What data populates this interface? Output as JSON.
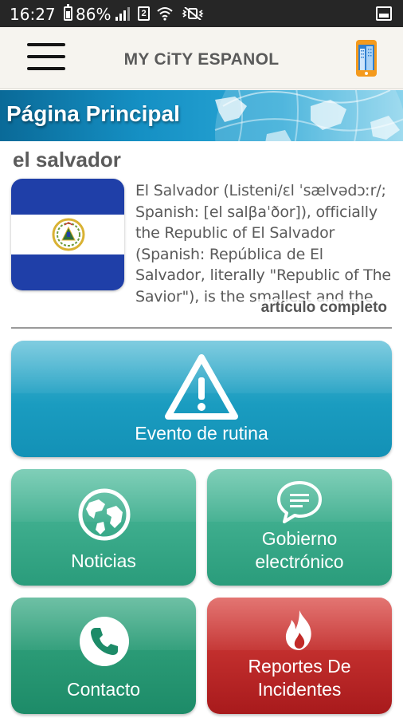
{
  "status_bar": {
    "time": "16:27",
    "battery": "86%",
    "sim_label": "2"
  },
  "app": {
    "title": "MY CiTY ESPANOL"
  },
  "banner": {
    "title": "Página Principal"
  },
  "article": {
    "heading": "el salvador",
    "text": "El Salvador (Listeni/ɛl ˈsælvədɔːr/; Spanish: [el salβaˈðor]), officially the Republic of El Salvador (Spanish: República de El Salvador, literally \"Republic of The Savior\"), is the smallest and the most densely populated country in Central America.",
    "read_more": "artículo completo"
  },
  "tiles": {
    "evento": {
      "label": "Evento de rutina",
      "icon": "warning-icon"
    },
    "noticias": {
      "label": "Noticias",
      "icon": "globe-icon"
    },
    "gobierno": {
      "label_line1": "Gobierno",
      "label_line2": "electrónico",
      "icon": "chat-bubble-icon"
    },
    "contacto": {
      "label": "Contacto",
      "icon": "phone-icon"
    },
    "reportes": {
      "label_line1": "Reportes De",
      "label_line2": "Incidentes",
      "icon": "fire-icon"
    }
  },
  "colors": {
    "evento_tile": "#1a9cc0",
    "green_tile": "#2a9c7b",
    "red_tile": "#a81a1c",
    "flag_blue": "#1f3fa8"
  }
}
